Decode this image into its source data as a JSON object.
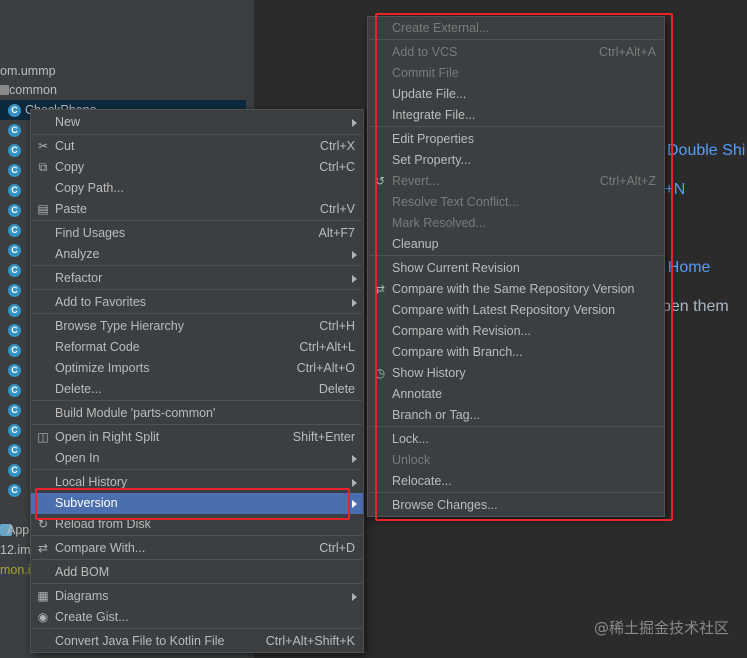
{
  "project_tree": {
    "package_label": "om.ummp",
    "folder_label": "common",
    "selected_item": "CheckPhone",
    "bottom_labels": [
      "App",
      "12.im",
      "mon.i"
    ]
  },
  "editor": {
    "hint_double_shift": "Double Shi",
    "hint_ctrl_n": "t+N",
    "hint_home": "- Home",
    "hint_open_them": "pen them"
  },
  "watermark": "@稀土掘金技术社区",
  "context_menu": {
    "items": [
      {
        "label": "New",
        "shortcut": "",
        "submenu": true
      },
      {
        "label": "Cut",
        "shortcut": "Ctrl+X",
        "icon": "scissors-icon"
      },
      {
        "label": "Copy",
        "shortcut": "Ctrl+C",
        "icon": "copy-icon"
      },
      {
        "label": "Copy Path...",
        "shortcut": ""
      },
      {
        "label": "Paste",
        "shortcut": "Ctrl+V",
        "icon": "paste-icon"
      },
      {
        "label": "Find Usages",
        "shortcut": "Alt+F7"
      },
      {
        "label": "Analyze",
        "shortcut": "",
        "submenu": true
      },
      {
        "label": "Refactor",
        "shortcut": "",
        "submenu": true
      },
      {
        "label": "Add to Favorites",
        "shortcut": "",
        "submenu": true
      },
      {
        "label": "Browse Type Hierarchy",
        "shortcut": "Ctrl+H"
      },
      {
        "label": "Reformat Code",
        "shortcut": "Ctrl+Alt+L"
      },
      {
        "label": "Optimize Imports",
        "shortcut": "Ctrl+Alt+O"
      },
      {
        "label": "Delete...",
        "shortcut": "Delete"
      },
      {
        "label": "Build Module 'parts-common'",
        "shortcut": ""
      },
      {
        "label": "Open in Right Split",
        "shortcut": "Shift+Enter",
        "icon": "split-icon"
      },
      {
        "label": "Open In",
        "shortcut": "",
        "submenu": true
      },
      {
        "label": "Local History",
        "shortcut": "",
        "submenu": true
      },
      {
        "label": "Subversion",
        "shortcut": "",
        "submenu": true,
        "active": true
      },
      {
        "label": "Reload from Disk",
        "shortcut": "",
        "icon": "reload-icon"
      },
      {
        "label": "Compare With...",
        "shortcut": "Ctrl+D",
        "icon": "compare-icon"
      },
      {
        "label": "Add BOM",
        "shortcut": ""
      },
      {
        "label": "Diagrams",
        "shortcut": "",
        "submenu": true,
        "icon": "diagram-icon"
      },
      {
        "label": "Create Gist...",
        "shortcut": "",
        "icon": "github-icon"
      },
      {
        "label": "Convert Java File to Kotlin File",
        "shortcut": "Ctrl+Alt+Shift+K"
      }
    ]
  },
  "subversion_menu": {
    "items": [
      {
        "label": "Create External...",
        "shortcut": "",
        "disabled": true
      },
      {
        "label": "Add to VCS",
        "shortcut": "Ctrl+Alt+A",
        "disabled": true
      },
      {
        "label": "Commit File",
        "shortcut": "",
        "disabled": true
      },
      {
        "label": "Update File...",
        "shortcut": ""
      },
      {
        "label": "Integrate File...",
        "shortcut": ""
      },
      {
        "label": "Edit Properties",
        "shortcut": ""
      },
      {
        "label": "Set Property...",
        "shortcut": ""
      },
      {
        "label": "Revert...",
        "shortcut": "Ctrl+Alt+Z",
        "disabled": true,
        "icon": "revert-icon"
      },
      {
        "label": "Resolve Text Conflict...",
        "shortcut": "",
        "disabled": true
      },
      {
        "label": "Mark Resolved...",
        "shortcut": "",
        "disabled": true
      },
      {
        "label": "Cleanup",
        "shortcut": ""
      },
      {
        "label": "Show Current Revision",
        "shortcut": ""
      },
      {
        "label": "Compare with the Same Repository Version",
        "shortcut": "",
        "icon": "compare-icon"
      },
      {
        "label": "Compare with Latest Repository Version",
        "shortcut": ""
      },
      {
        "label": "Compare with Revision...",
        "shortcut": ""
      },
      {
        "label": "Compare with Branch...",
        "shortcut": ""
      },
      {
        "label": "Show History",
        "shortcut": "",
        "icon": "history-icon"
      },
      {
        "label": "Annotate",
        "shortcut": ""
      },
      {
        "label": "Branch or Tag...",
        "shortcut": ""
      },
      {
        "label": "Lock...",
        "shortcut": ""
      },
      {
        "label": "Unlock",
        "shortcut": "",
        "disabled": true
      },
      {
        "label": "Relocate...",
        "shortcut": ""
      },
      {
        "label": "Browse Changes...",
        "shortcut": ""
      }
    ]
  },
  "colors": {
    "menu_bg": "#3c3f41",
    "active_bg": "#4b6eaf",
    "highlight_box": "#e8232a",
    "link_blue": "#589df6"
  }
}
